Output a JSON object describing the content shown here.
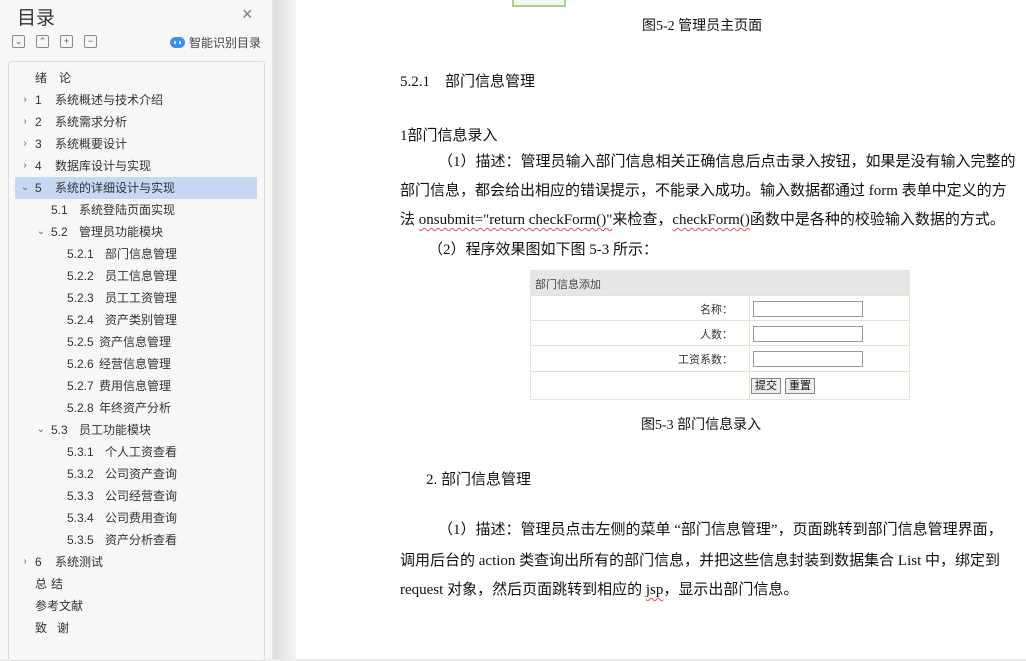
{
  "sidebar": {
    "title": "目录",
    "ai_button_label": "智能识别目录",
    "toc": [
      {
        "num": "绪",
        "text": "论"
      },
      {
        "num": "1",
        "text": "系统概述与技术介绍"
      },
      {
        "num": "2",
        "text": "系统需求分析"
      },
      {
        "num": "3",
        "text": "系统概要设计"
      },
      {
        "num": "4",
        "text": "数据库设计与实现"
      },
      {
        "num": "5",
        "text": "系统的详细设计与实现"
      },
      {
        "num": "5.1",
        "text": "系统登陆页面实现"
      },
      {
        "num": "5.2",
        "text": "管理员功能模块"
      },
      {
        "num": "5.2.1",
        "text": "部门信息管理"
      },
      {
        "num": "5.2.2",
        "text": "员工信息管理"
      },
      {
        "num": "5.2.3",
        "text": "员工工资管理"
      },
      {
        "num": "5.2.4",
        "text": "资产类别管理"
      },
      {
        "num": "5.2.5",
        "text": "资产信息管理"
      },
      {
        "num": "5.2.6",
        "text": "经营信息管理"
      },
      {
        "num": "5.2.7",
        "text": "费用信息管理"
      },
      {
        "num": "5.2.8",
        "text": "年终资产分析"
      },
      {
        "num": "5.3",
        "text": "员工功能模块"
      },
      {
        "num": "5.3.1",
        "text": "个人工资查看"
      },
      {
        "num": "5.3.2",
        "text": "公司资产查询"
      },
      {
        "num": "5.3.3",
        "text": "公司经营查询"
      },
      {
        "num": "5.3.4",
        "text": "公司费用查询"
      },
      {
        "num": "5.3.5",
        "text": "资产分析查看"
      },
      {
        "num": "6",
        "text": "系统测试"
      },
      {
        "num": "总",
        "text": "结"
      },
      {
        "num": "",
        "text": "参考文献"
      },
      {
        "num": "致",
        "text": "谢"
      }
    ]
  },
  "document": {
    "fig52_caption": "图5-2 管理员主页面",
    "section_heading": "5.2.1　部门信息管理",
    "sub1_heading": "1部门信息录入",
    "p1_line1": "（1）描述：管理员输入部门信息相关正确信息后点击录入按钮，如果是没有输入完整的",
    "p1_line2": "部门信息，都会给出相应的错误提示，不能录入成功。输入数据都通过 form 表单中定义的方",
    "p1_line3_a": "法 ",
    "p1_line3_b": "onsubmit=\"return checkForm()\"",
    "p1_line3_c": "来检查，",
    "p1_line3_d": "checkForm()",
    "p1_line3_e": "函数中是各种的校验输入数据的方式。",
    "p2": "（2）程序效果图如下图 5-3 所示：",
    "form": {
      "header": "部门信息添加",
      "labels": [
        "名称：",
        "人数：",
        "工资系数："
      ],
      "submit": "提交",
      "reset": "重置"
    },
    "fig53_caption": "图5-3 部门信息录入",
    "sub2_heading": "2. 部门信息管理",
    "p3_line1": "（1）描述：管理员点击左侧的菜单 “部门信息管理”，页面跳转到部门信息管理界面，",
    "p3_line2": "调用后台的 action 类查询出所有的部门信息，并把这些信息封装到数据集合 List 中，绑定到",
    "p3_line3_a": "request 对象，然后页面跳转到相应的 ",
    "p3_line3_b": "jsp",
    "p3_line3_c": "，显示出部门信息。"
  }
}
